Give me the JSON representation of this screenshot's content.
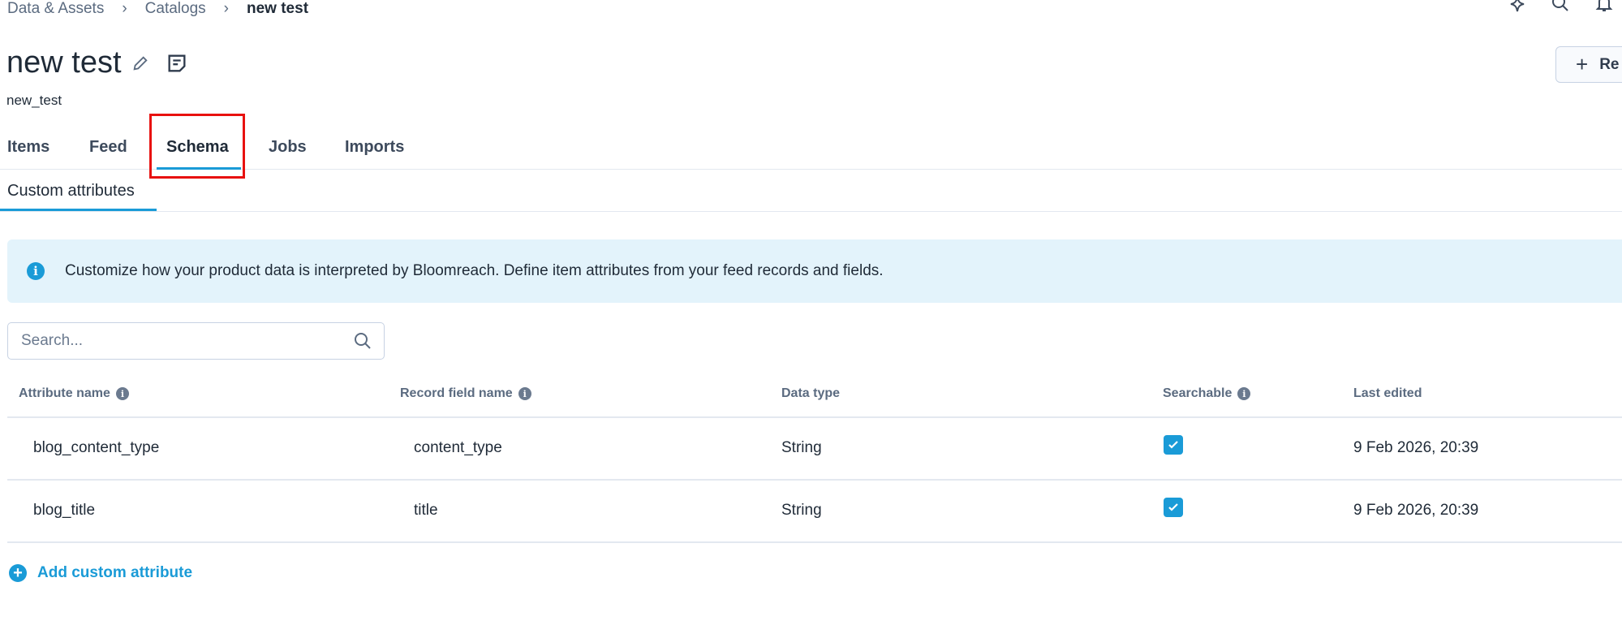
{
  "breadcrumb": [
    "Data & Assets",
    "Catalogs",
    "new test"
  ],
  "header": {
    "title": "new test",
    "subtitle": "new_test",
    "right_button": "Re"
  },
  "tabs": [
    "Items",
    "Feed",
    "Schema",
    "Jobs",
    "Imports"
  ],
  "active_tab": "Schema",
  "subtabs": [
    "Custom attributes"
  ],
  "banner": {
    "text": "Customize how your product data is interpreted by Bloomreach. Define item attributes from your feed records and fields."
  },
  "search": {
    "placeholder": "Search...",
    "value": ""
  },
  "table": {
    "headers": [
      "Attribute name",
      "Record field name",
      "Data type",
      "Searchable",
      "Last edited"
    ],
    "rows": [
      {
        "attribute": "blog_content_type",
        "field": "content_type",
        "type": "String",
        "searchable": true,
        "edited": "9 Feb 2026, 20:39"
      },
      {
        "attribute": "blog_title",
        "field": "title",
        "type": "String",
        "searchable": true,
        "edited": "9 Feb 2026, 20:39"
      }
    ]
  },
  "add_label": "Add custom attribute",
  "colors": {
    "accent": "#1a9bd7",
    "highlight": "#e8110f",
    "banner": "#e3f3fb"
  }
}
